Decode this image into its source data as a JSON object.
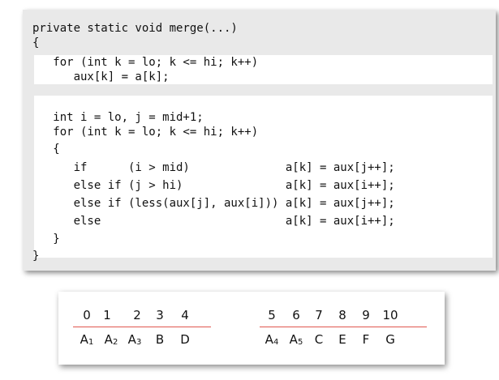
{
  "code": {
    "lines": [
      "private static void merge(...)",
      "{",
      "   for (int k = lo; k <= hi; k++)",
      "      aux[k] = a[k];",
      "",
      "   int i = lo, j = mid+1;",
      "   for (int k = lo; k <= hi; k++)",
      "   {",
      "      if      (i > mid)              a[k] = aux[j++];",
      "      else if (j > hi)               a[k] = aux[i++];",
      "      else if (less(aux[j], aux[i])) a[k] = aux[j++];",
      "      else                           a[k] = aux[i++];",
      "   }",
      "}"
    ]
  },
  "array": {
    "left": {
      "indices": [
        "0",
        "1",
        "2",
        "3",
        "4"
      ],
      "values": [
        {
          "base": "A",
          "sub": "1"
        },
        {
          "base": "A",
          "sub": "2"
        },
        {
          "base": "A",
          "sub": "3"
        },
        {
          "base": "B",
          "sub": ""
        },
        {
          "base": "D",
          "sub": ""
        }
      ]
    },
    "right": {
      "indices": [
        "5",
        "6",
        "7",
        "8",
        "9",
        "10"
      ],
      "values": [
        {
          "base": "A",
          "sub": "4"
        },
        {
          "base": "A",
          "sub": "5"
        },
        {
          "base": "C",
          "sub": ""
        },
        {
          "base": "E",
          "sub": ""
        },
        {
          "base": "F",
          "sub": ""
        },
        {
          "base": "G",
          "sub": ""
        }
      ]
    }
  }
}
